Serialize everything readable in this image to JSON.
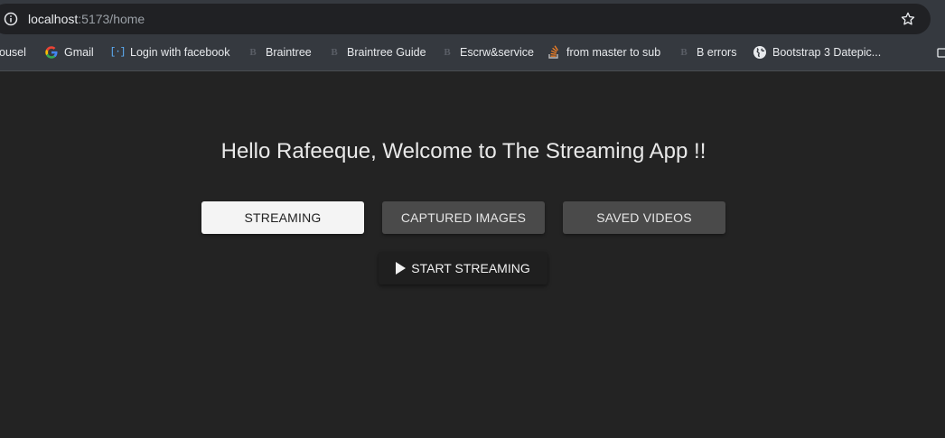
{
  "browser": {
    "url_host": "localhost",
    "url_path": ":5173/home",
    "info_icon": "info-icon",
    "star_icon": "star-icon"
  },
  "bookmarks": [
    {
      "label": "ousel",
      "icon": "none"
    },
    {
      "label": "Gmail",
      "icon": "google-icon"
    },
    {
      "label": "Login with facebook",
      "icon": "bracket-icon"
    },
    {
      "label": "Braintree",
      "icon": "b-icon"
    },
    {
      "label": "Braintree Guide",
      "icon": "b-icon"
    },
    {
      "label": "Escrw&service",
      "icon": "b-icon"
    },
    {
      "label": "from master to sub",
      "icon": "stackoverflow-icon"
    },
    {
      "label": "B errors",
      "icon": "b-icon"
    },
    {
      "label": "Bootstrap 3 Datepic...",
      "icon": "globe-icon"
    }
  ],
  "page": {
    "welcome": "Hello Rafeeque, Welcome to The Streaming App !!",
    "tabs": [
      {
        "label": "STREAMING",
        "active": true
      },
      {
        "label": "CAPTURED IMAGES",
        "active": false
      },
      {
        "label": "SAVED VIDEOS",
        "active": false
      }
    ],
    "start_button": "START STREAMING",
    "start_icon": "play-icon"
  },
  "colors": {
    "page_background": "#232323",
    "active_tab": "#f4f4f4",
    "inactive_tab": "#4a4a4a"
  }
}
